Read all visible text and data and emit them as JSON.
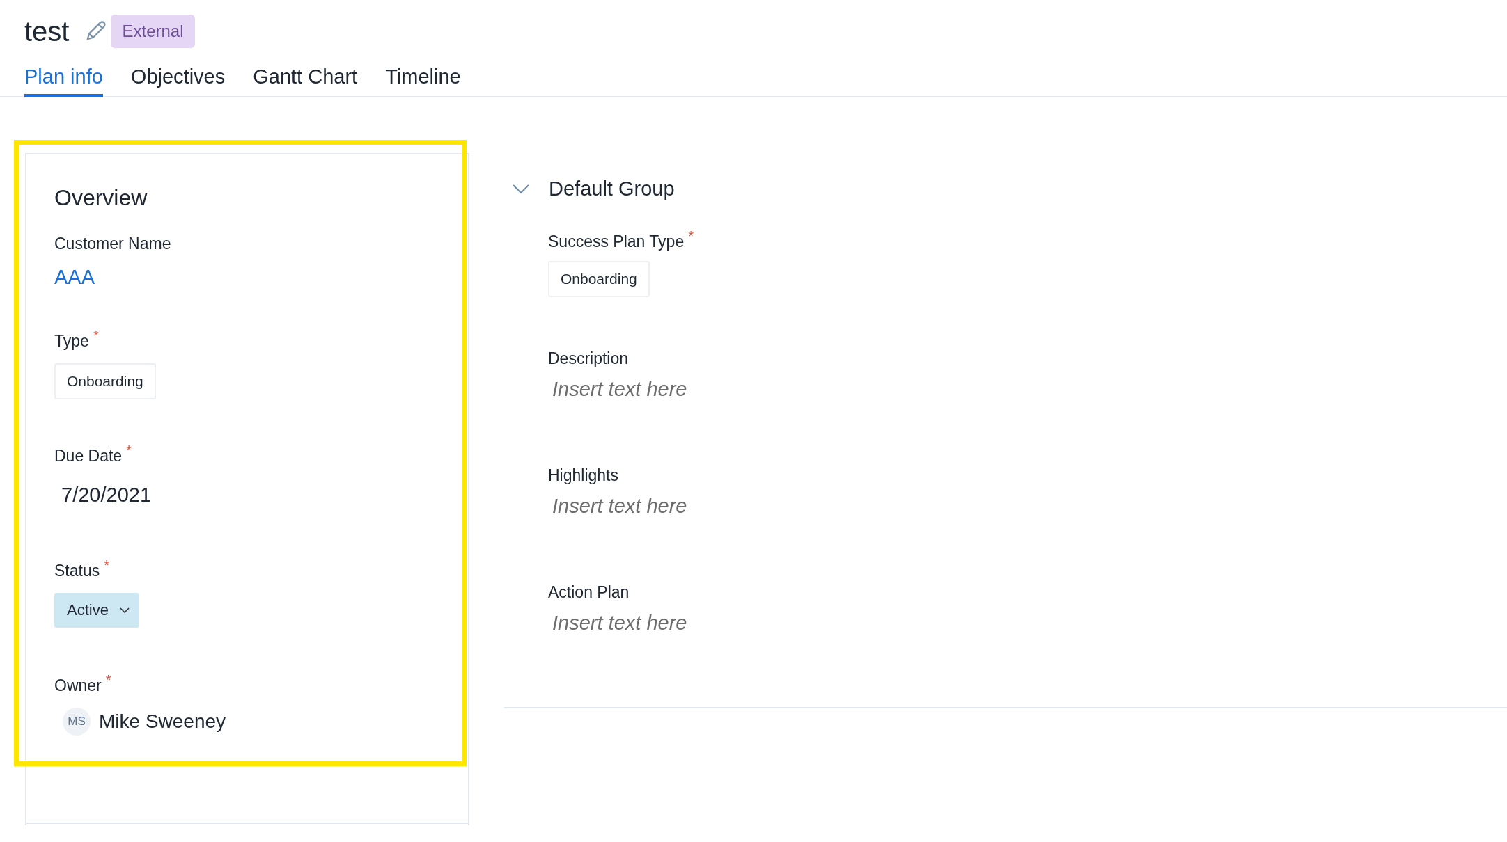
{
  "header": {
    "title": "test",
    "badge": "External"
  },
  "tabs": [
    {
      "label": "Plan info",
      "selected": true
    },
    {
      "label": "Objectives",
      "selected": false
    },
    {
      "label": "Gantt Chart",
      "selected": false
    },
    {
      "label": "Timeline",
      "selected": false
    }
  ],
  "overview": {
    "title": "Overview",
    "highlighted": true,
    "fields": [
      {
        "kind": "link",
        "label": "Customer Name",
        "value": "AAA"
      },
      {
        "kind": "chip",
        "label": "Type",
        "required_mark": "*",
        "value": "Onboarding"
      },
      {
        "kind": "date",
        "label": "Due Date",
        "required_mark": "*",
        "value": "7/20/2021"
      },
      {
        "kind": "status",
        "label": "Status",
        "required_mark": "*",
        "value": "Active"
      },
      {
        "kind": "user",
        "label": "Owner",
        "required_mark": "*",
        "initials": "MS",
        "value": "Mike Sweeney"
      }
    ]
  },
  "group": {
    "title": "Default Group",
    "expanded": true,
    "fields": [
      {
        "kind": "chip",
        "label": "Success Plan Type",
        "required_mark": "*",
        "value": "Onboarding"
      },
      {
        "kind": "text",
        "label": "Description",
        "placeholder": "Insert text here"
      },
      {
        "kind": "text",
        "label": "Highlights",
        "placeholder": "Insert text here"
      },
      {
        "kind": "text",
        "label": "Action Plan",
        "placeholder": "Insert text here"
      }
    ]
  }
}
